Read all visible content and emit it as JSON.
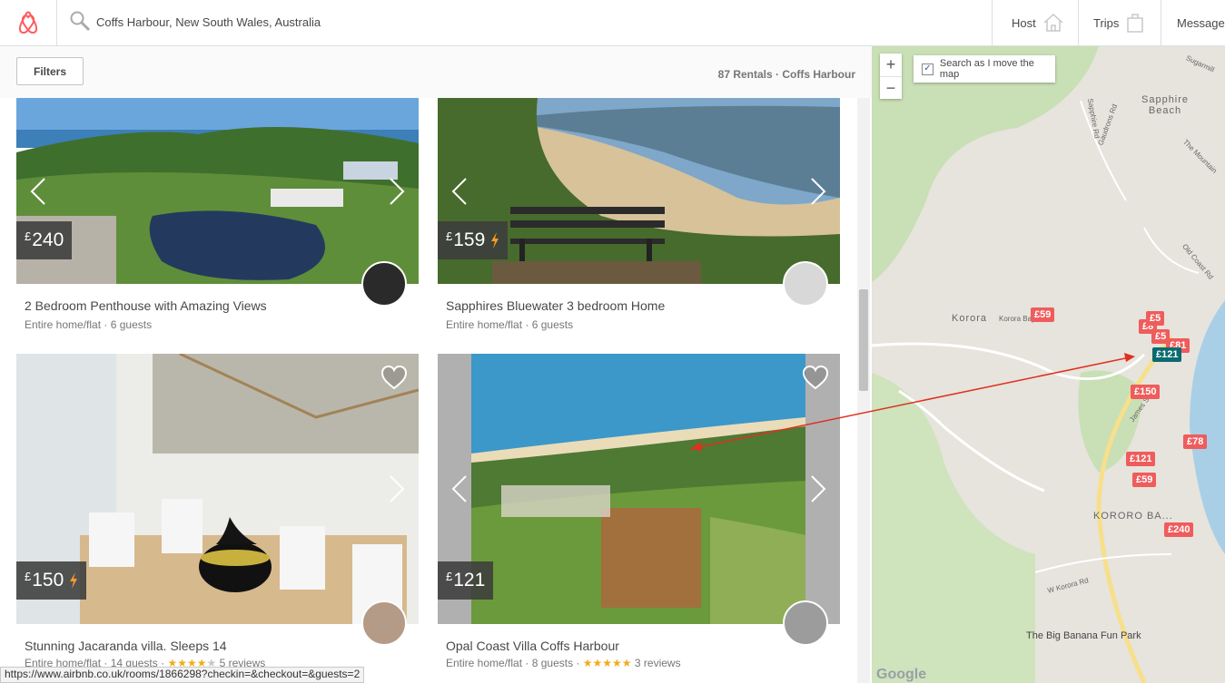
{
  "header": {
    "search_value": "Coffs Harbour, New South Wales, Australia",
    "nav": {
      "host": "Host",
      "trips": "Trips",
      "messages": "Messages"
    }
  },
  "toolbar": {
    "filters": "Filters",
    "rentals": "87 Rentals · Coffs Harbour"
  },
  "listings": [
    {
      "currency": "£",
      "price": "240",
      "instant": false,
      "title": "2 Bedroom Penthouse with Amazing Views",
      "type": "Entire home/flat",
      "guests": "6 guests",
      "rating": 0,
      "reviews": ""
    },
    {
      "currency": "£",
      "price": "159",
      "instant": true,
      "title": "Sapphires Bluewater 3 bedroom Home",
      "type": "Entire home/flat",
      "guests": "6 guests",
      "rating": 0,
      "reviews": ""
    },
    {
      "currency": "£",
      "price": "150",
      "instant": true,
      "title": "Stunning Jacaranda villa. Sleeps 14",
      "type": "Entire home/flat",
      "guests": "14 guests",
      "rating": 4,
      "reviews": "5 reviews"
    },
    {
      "currency": "£",
      "price": "121",
      "instant": false,
      "title": "Opal Coast Villa Coffs Harbour",
      "type": "Entire home/flat",
      "guests": "8 guests",
      "rating": 5,
      "reviews": "3 reviews"
    }
  ],
  "status_url": "https://www.airbnb.co.uk/rooms/1866298?checkin=&checkout=&guests=2",
  "map": {
    "search_as_move": "Search as I move the map",
    "zoom_in": "+",
    "zoom_out": "−",
    "labels": {
      "sapphire_beach": "Sapphire\nBeach",
      "korora": "Korora",
      "korora_bay": "KORORO BA...",
      "big_banana": "The Big Banana Fun Park",
      "korora_bay_rd": "Korora Bay Rd",
      "w_korora_rd": "W Korora Rd",
      "old_coast_rd": "Old Coast Rd",
      "gaudrons_rd": "Gaudrons Rd",
      "sapphire_rd": "Sapphire Rd",
      "the_mountain": "The Mountain",
      "james_small": "James Small",
      "sugarmill": "Sugarmill"
    },
    "pins": [
      "£59",
      "£8",
      "£5",
      "£5",
      "£81",
      "£121",
      "£150",
      "£78",
      "£121",
      "£59",
      "£240"
    ],
    "google": "Google"
  },
  "colors": {
    "brand": "#ff5a5f",
    "pin": "#ef5c5c",
    "pin_selected": "#0c6a70",
    "star": "#f0ad1a"
  }
}
